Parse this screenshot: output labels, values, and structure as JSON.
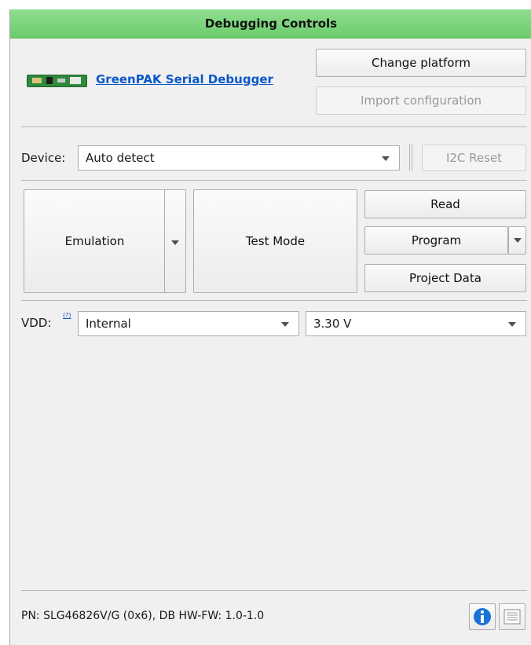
{
  "panel": {
    "title": "Debugging Controls"
  },
  "platform": {
    "link_label": "GreenPAK Serial Debugger",
    "board_icon": "green-circuit-board-icon",
    "change_platform": "Change platform",
    "import_configuration": "Import configuration"
  },
  "device": {
    "label": "Device:",
    "selected": "Auto detect",
    "i2c_reset": "I2C Reset"
  },
  "modes": {
    "emulation": "Emulation",
    "test_mode": "Test Mode",
    "read": "Read",
    "program": "Program",
    "project_data": "Project Data"
  },
  "vdd": {
    "label": "VDD:",
    "help_mark": "(?)",
    "source_selected": "Internal",
    "voltage_selected": "3.30 V"
  },
  "status": {
    "text": "PN: SLG46826V/G (0x6), DB HW-FW: 1.0-1.0",
    "info_icon": "info-icon",
    "log_icon": "log-window-icon"
  },
  "colors": {
    "title_green": "#7ed67e",
    "link_blue": "#0a58ca",
    "info_blue": "#1a73d9"
  }
}
